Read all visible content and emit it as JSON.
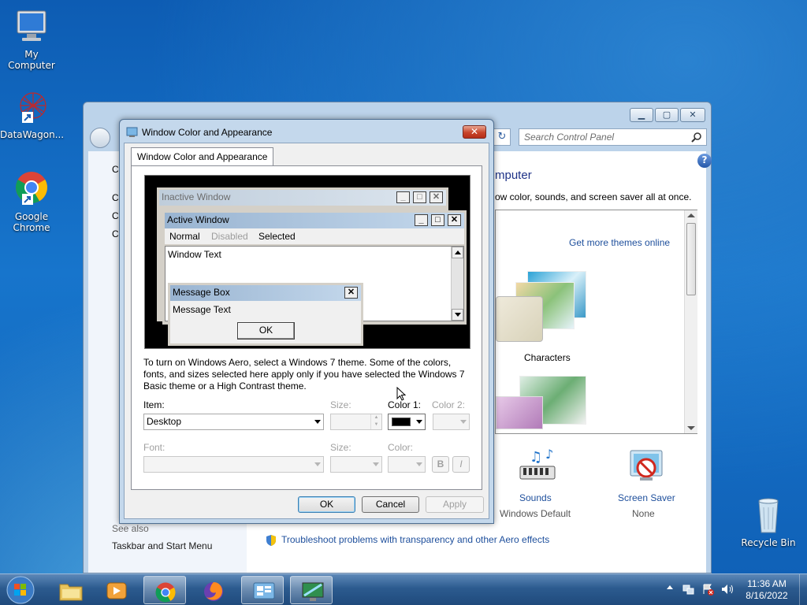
{
  "desktop": {
    "icons": [
      {
        "label": "My Computer"
      },
      {
        "label": "DataWagon..."
      },
      {
        "label": "Google Chrome"
      },
      {
        "label": "Recycle Bin"
      }
    ]
  },
  "control_panel": {
    "search_placeholder": "Search Control Panel",
    "left_letters": [
      "C",
      "C",
      "C",
      "C"
    ],
    "heading": "mputer",
    "description": "ow color, sounds, and screen saver all at once.",
    "more_themes_link": "Get more themes online",
    "theme_label": "Characters",
    "sounds_label": "Sounds",
    "sounds_value": "Windows Default",
    "screensaver_label": "Screen Saver",
    "screensaver_value": "None",
    "see_also": "See also",
    "taskbar_link": "Taskbar and Start Menu",
    "troubleshoot_link": "Troubleshoot problems with transparency and other Aero effects"
  },
  "dialog": {
    "title": "Window Color and Appearance",
    "tab": "Window Color and Appearance",
    "preview": {
      "inactive_title": "Inactive Window",
      "active_title": "Active Window",
      "menu_normal": "Normal",
      "menu_disabled": "Disabled",
      "menu_selected": "Selected",
      "window_text": "Window Text",
      "msgbox_title": "Message Box",
      "msgbox_text": "Message Text",
      "msgbox_ok": "OK"
    },
    "info_text": "To turn on Windows Aero, select a Windows 7 theme.  Some of the colors, fonts, and sizes selected here apply only if you have selected the Windows 7 Basic theme or a High Contrast theme.",
    "item_label": "Item:",
    "item_value": "Desktop",
    "size_label": "Size:",
    "color1_label": "Color 1:",
    "color2_label": "Color 2:",
    "color1_value": "#000000",
    "font_label": "Font:",
    "font_size_label": "Size:",
    "font_color_label": "Color:",
    "bold_label": "B",
    "italic_label": "I",
    "ok_label": "OK",
    "cancel_label": "Cancel",
    "apply_label": "Apply"
  },
  "taskbar": {
    "time": "11:36 AM",
    "date": "8/16/2022",
    "items": [
      "start-button",
      "explorer",
      "media-player",
      "chrome",
      "firefox",
      "control-panel",
      "display-settings"
    ]
  }
}
